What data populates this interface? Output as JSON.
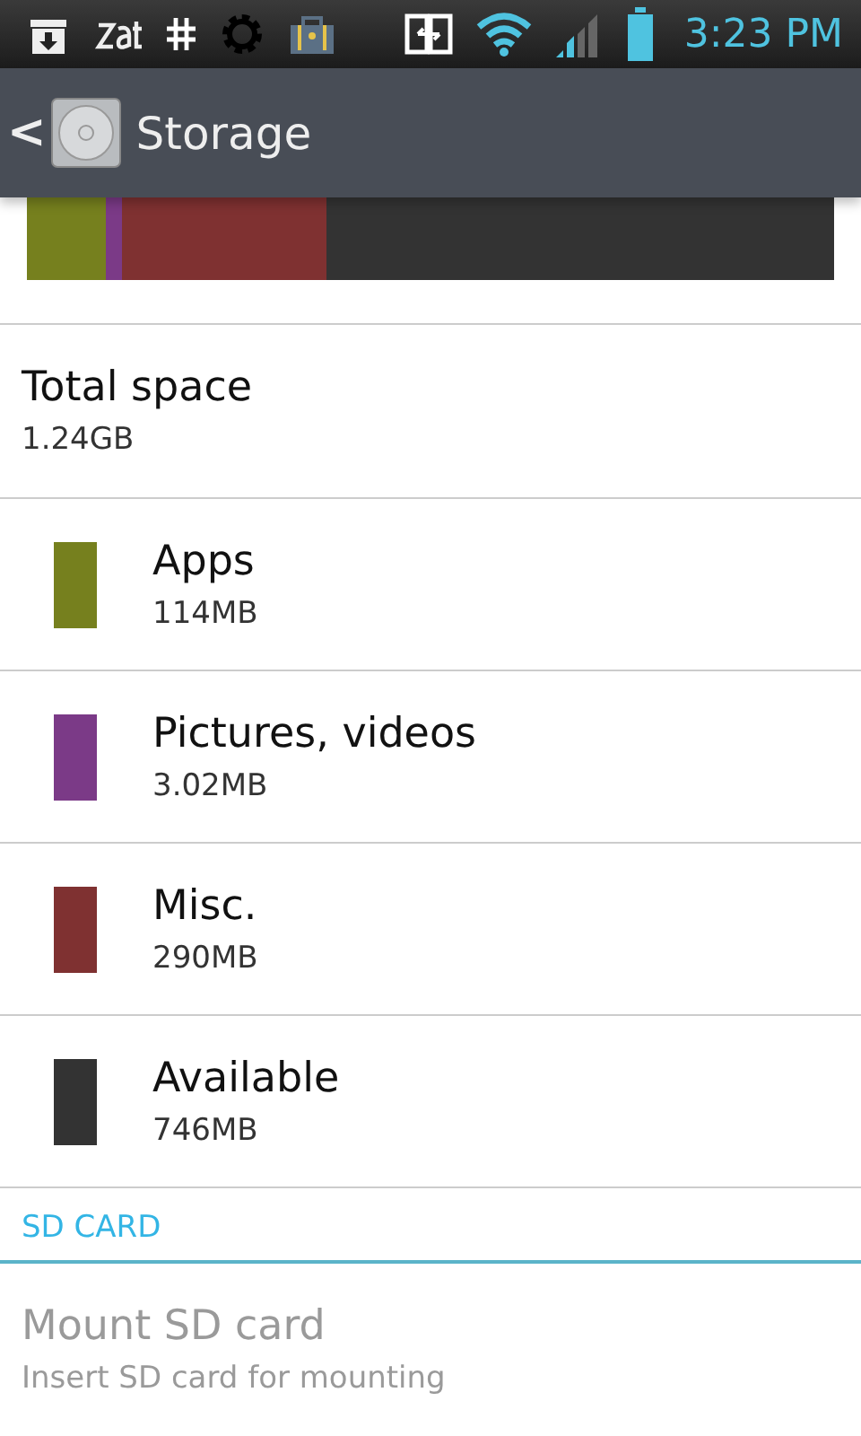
{
  "status_bar": {
    "time": "3:23 PM"
  },
  "action_bar": {
    "back": "<",
    "title": "Storage"
  },
  "total": {
    "label": "Total space",
    "value": "1.24GB"
  },
  "categories": [
    {
      "name": "Apps",
      "size": "114MB",
      "color": "#76801e",
      "kind": "used"
    },
    {
      "name": "Pictures, videos",
      "size": "3.02MB",
      "color": "#7b3a87",
      "kind": "used"
    },
    {
      "name": "Misc.",
      "size": "290MB",
      "color": "#7f3131",
      "kind": "used"
    },
    {
      "name": "Available",
      "size": "746MB",
      "color": "#333333",
      "kind": "free"
    }
  ],
  "sd_section": {
    "header": "SD CARD",
    "items": [
      {
        "title": "Mount SD card",
        "summary": "Insert SD card for mounting",
        "disabled": true
      }
    ]
  }
}
